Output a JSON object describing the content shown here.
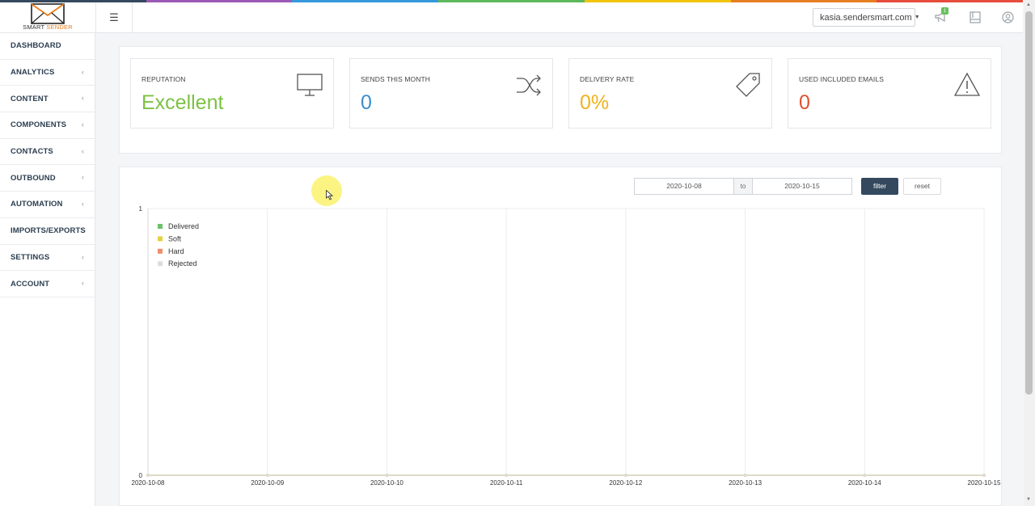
{
  "brand": {
    "logo_word1": "SMART",
    "logo_word2": "SENDER",
    "stripe_colors": [
      "#34495e",
      "#9b59b6",
      "#3498db",
      "#5cb85c",
      "#f1c40f",
      "#e67e22",
      "#e74c3c"
    ]
  },
  "header": {
    "menu_icon": "hamburger-icon",
    "domain": "kasia.sendersmart.com",
    "notification_count": "1",
    "icons": [
      "megaphone-icon",
      "book-icon",
      "user-icon"
    ]
  },
  "sidebar": {
    "items": [
      {
        "label": "DASHBOARD",
        "has_submenu": false
      },
      {
        "label": "ANALYTICS",
        "has_submenu": true
      },
      {
        "label": "CONTENT",
        "has_submenu": true
      },
      {
        "label": "COMPONENTS",
        "has_submenu": true
      },
      {
        "label": "CONTACTS",
        "has_submenu": true
      },
      {
        "label": "OUTBOUND",
        "has_submenu": true
      },
      {
        "label": "AUTOMATION",
        "has_submenu": true
      },
      {
        "label": "IMPORTS/EXPORTS",
        "has_submenu": false
      },
      {
        "label": "SETTINGS",
        "has_submenu": true
      },
      {
        "label": "ACCOUNT",
        "has_submenu": true
      }
    ]
  },
  "stats": [
    {
      "label": "REPUTATION",
      "value": "Excellent",
      "color": "#7cc242",
      "icon": "monitor-icon"
    },
    {
      "label": "SENDS THIS MONTH",
      "value": "0",
      "color": "#3c8dcb",
      "icon": "shuffle-icon"
    },
    {
      "label": "DELIVERY RATE",
      "value": "0%",
      "color": "#f0b21e",
      "icon": "tag-icon"
    },
    {
      "label": "USED INCLUDED EMAILS",
      "value": "0",
      "color": "#e0522f",
      "icon": "warning-icon"
    }
  ],
  "filter": {
    "date_from": "2020-10-08",
    "to_label": "to",
    "date_to": "2020-10-15",
    "filter_label": "filter",
    "reset_label": "reset"
  },
  "chart_data": {
    "type": "line",
    "x": [
      "2020-10-08",
      "2020-10-09",
      "2020-10-10",
      "2020-10-11",
      "2020-10-12",
      "2020-10-13",
      "2020-10-14",
      "2020-10-15"
    ],
    "series": [
      {
        "name": "Delivered",
        "color": "#6cc26b",
        "values": [
          0,
          0,
          0,
          0,
          0,
          0,
          0,
          0
        ]
      },
      {
        "name": "Soft",
        "color": "#e3d33f",
        "values": [
          0,
          0,
          0,
          0,
          0,
          0,
          0,
          0
        ]
      },
      {
        "name": "Hard",
        "color": "#ef8f69",
        "values": [
          0,
          0,
          0,
          0,
          0,
          0,
          0,
          0
        ]
      },
      {
        "name": "Rejected",
        "color": "#dddddd",
        "values": [
          0,
          0,
          0,
          0,
          0,
          0,
          0,
          0
        ]
      }
    ],
    "ylim": [
      0,
      1
    ],
    "yticks": [
      "0",
      "1"
    ],
    "legend_position": "top-left",
    "grid": true
  }
}
